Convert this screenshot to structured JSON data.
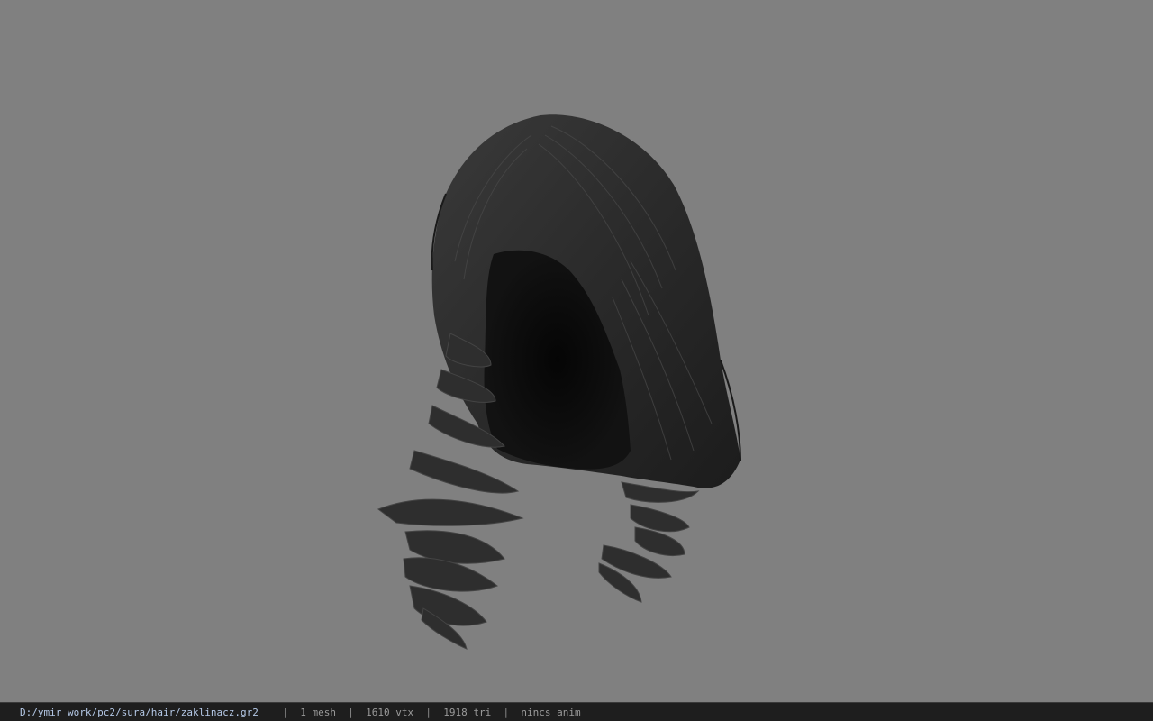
{
  "viewport": {
    "background": "#808080",
    "model": "hair-model"
  },
  "statusbar": {
    "file_path": "D:/ymir work/pc2/sura/hair/zaklinacz.gr2",
    "separator": "|",
    "mesh_count": "1 mesh",
    "vertex_count": "1610 vtx",
    "triangle_count": "1918 tri",
    "anim_status": "nincs anim"
  }
}
